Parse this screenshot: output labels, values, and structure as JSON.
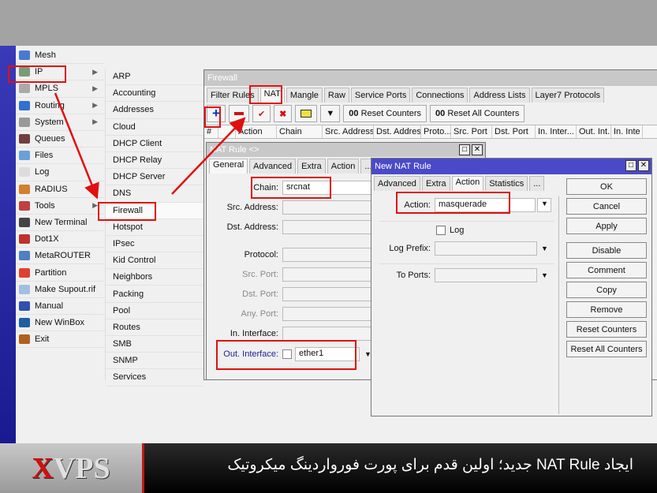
{
  "main_menu": [
    {
      "label": "Mesh",
      "icon": "mesh-icon",
      "color": "#4a7ad0",
      "submenu": false
    },
    {
      "label": "IP",
      "icon": "ip-icon",
      "color": "#7a9a7a",
      "submenu": true
    },
    {
      "label": "MPLS",
      "icon": "mpls-icon",
      "color": "#aaaaaa",
      "submenu": true
    },
    {
      "label": "Routing",
      "icon": "routing-icon",
      "color": "#3070d0",
      "submenu": true
    },
    {
      "label": "System",
      "icon": "gear-icon",
      "color": "#999999",
      "submenu": true
    },
    {
      "label": "Queues",
      "icon": "queues-icon",
      "color": "#704040",
      "submenu": false
    },
    {
      "label": "Files",
      "icon": "folder-icon",
      "color": "#6aa0d8",
      "submenu": false
    },
    {
      "label": "Log",
      "icon": "log-icon",
      "color": "#dddddd",
      "submenu": false
    },
    {
      "label": "RADIUS",
      "icon": "radius-icon",
      "color": "#d08030",
      "submenu": false
    },
    {
      "label": "Tools",
      "icon": "tools-icon",
      "color": "#c04040",
      "submenu": true
    },
    {
      "label": "New Terminal",
      "icon": "terminal-icon",
      "color": "#444444",
      "submenu": false
    },
    {
      "label": "Dot1X",
      "icon": "dot1x-icon",
      "color": "#c03030",
      "submenu": false
    },
    {
      "label": "MetaROUTER",
      "icon": "metarouter-icon",
      "color": "#5080c0",
      "submenu": false
    },
    {
      "label": "Partition",
      "icon": "partition-icon",
      "color": "#e04030",
      "submenu": false
    },
    {
      "label": "Make Supout.rif",
      "icon": "file-icon",
      "color": "#a0c0e0",
      "submenu": false
    },
    {
      "label": "Manual",
      "icon": "help-icon",
      "color": "#3050b0",
      "submenu": false
    },
    {
      "label": "New WinBox",
      "icon": "winbox-icon",
      "color": "#2060a0",
      "submenu": false
    },
    {
      "label": "Exit",
      "icon": "exit-icon",
      "color": "#b06020",
      "submenu": false
    }
  ],
  "ip_submenu": [
    "ARP",
    "Accounting",
    "Addresses",
    "Cloud",
    "DHCP Client",
    "DHCP Relay",
    "DHCP Server",
    "DNS",
    "Firewall",
    "Hotspot",
    "IPsec",
    "Kid Control",
    "Neighbors",
    "Packing",
    "Pool",
    "Routes",
    "SMB",
    "SNMP",
    "Services"
  ],
  "firewall": {
    "title": "Firewall",
    "tabs": [
      "Filter Rules",
      "NAT",
      "Mangle",
      "Raw",
      "Service Ports",
      "Connections",
      "Address Lists",
      "Layer7 Protocols"
    ],
    "active_tab": "NAT",
    "reset_counters": "Reset Counters",
    "reset_all_counters": "Reset All Counters",
    "counter_prefix": "00",
    "columns": [
      "#",
      "",
      "Action",
      "Chain",
      "Src. Address",
      "Dst. Address",
      "Proto...",
      "Src. Port",
      "Dst. Port",
      "In. Inter...",
      "Out. Int...",
      "In. Inte"
    ]
  },
  "nat_rule": {
    "title": "NAT Rule <>",
    "tabs": [
      "General",
      "Advanced",
      "Extra",
      "Action",
      "..."
    ],
    "fields": {
      "chain": {
        "label": "Chain:",
        "value": "srcnat"
      },
      "src_address": {
        "label": "Src. Address:",
        "value": ""
      },
      "dst_address": {
        "label": "Dst. Address:",
        "value": ""
      },
      "protocol": {
        "label": "Protocol:",
        "value": ""
      },
      "src_port": {
        "label": "Src. Port:",
        "value": ""
      },
      "dst_port": {
        "label": "Dst. Port:",
        "value": ""
      },
      "any_port": {
        "label": "Any. Port:",
        "value": ""
      },
      "in_interface": {
        "label": "In. Interface:",
        "value": ""
      },
      "out_interface": {
        "label": "Out. Interface:",
        "value": "ether1"
      }
    }
  },
  "new_nat_rule": {
    "title": "New NAT Rule",
    "tabs": [
      "Advanced",
      "Extra",
      "Action",
      "Statistics",
      "..."
    ],
    "active_tab": "Action",
    "action_label": "Action:",
    "action_value": "masquerade",
    "log_label": "Log",
    "log_checked": false,
    "log_prefix_label": "Log Prefix:",
    "to_ports_label": "To Ports:",
    "buttons": [
      "OK",
      "Cancel",
      "Apply",
      "Disable",
      "Comment",
      "Copy",
      "Remove",
      "Reset Counters",
      "Reset All Counters"
    ]
  },
  "banner": {
    "logo": "XVPS",
    "title": "ایجاد NAT Rule جدید؛ اولین قدم برای پورت فورواردینگ میکروتیک"
  },
  "colors": {
    "highlight": "#e01010",
    "dialog_title": "#4a4ac8",
    "sidebar": "#2a2aa8"
  }
}
